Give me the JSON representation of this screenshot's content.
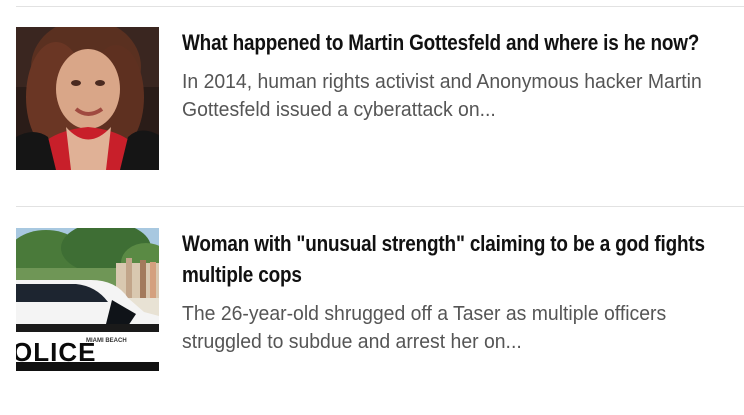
{
  "articles": [
    {
      "headline": "What happened to Martin Gottesfeld and where is he now?",
      "summary": "In 2014, human rights activist and Anonymous hacker Martin Gottesfeld issued a cyberattack on..."
    },
    {
      "headline": "Woman with \"unusual strength\" claiming to be a god fights multiple cops",
      "summary": "The 26-year-old shrugged off a Taser as multiple officers struggled to subdue and arrest her on...",
      "thumbnail_text": "OLICE",
      "thumbnail_small_text": "MIAMI BEACH"
    }
  ]
}
